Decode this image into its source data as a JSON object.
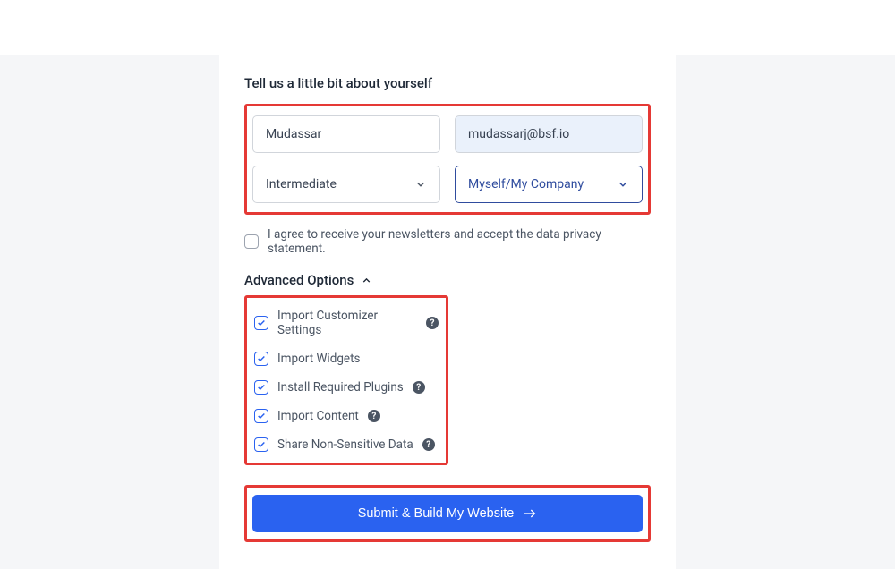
{
  "section_title": "Tell us a little bit about yourself",
  "fields": {
    "name": "Mudassar",
    "email": "mudassarj@bsf.io",
    "level": "Intermediate",
    "for_whom": "Myself/My Company"
  },
  "consent": {
    "label": "I agree to receive your newsletters and accept the data privacy statement.",
    "checked": false
  },
  "advanced": {
    "header": "Advanced Options",
    "options": [
      {
        "label": "Import Customizer Settings",
        "checked": true,
        "help": true
      },
      {
        "label": "Import Widgets",
        "checked": true,
        "help": false
      },
      {
        "label": "Install Required Plugins",
        "checked": true,
        "help": true
      },
      {
        "label": "Import Content",
        "checked": true,
        "help": true
      },
      {
        "label": "Share Non-Sensitive Data",
        "checked": true,
        "help": true
      }
    ]
  },
  "submit_label": "Submit & Build My Website"
}
